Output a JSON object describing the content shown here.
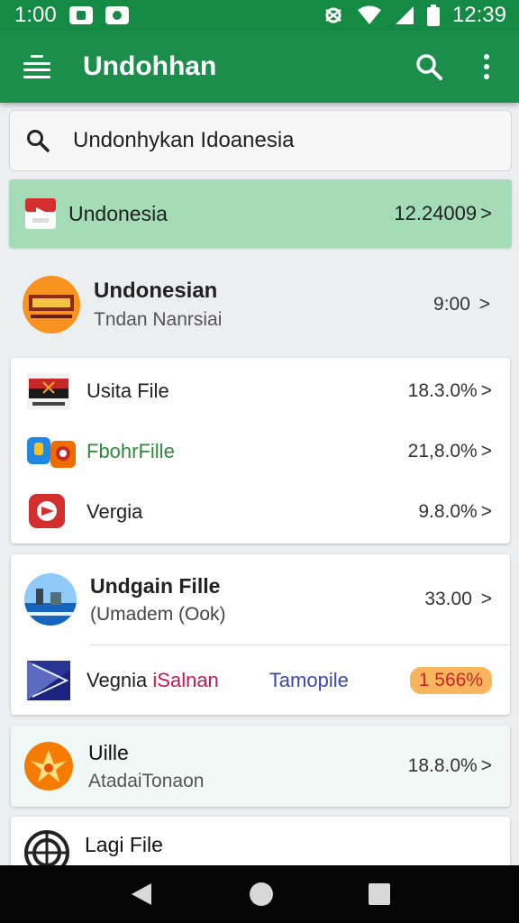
{
  "status_bar": {
    "time_left": "1:00",
    "time_right": "12:39"
  },
  "app_bar": {
    "title": "Undohhan"
  },
  "search": {
    "text": "Undonhykan Idoanesia"
  },
  "highlight_row": {
    "label": "Undonesia",
    "value": "12.24009",
    "chevron": ">"
  },
  "header_row": {
    "title": "Undonesian",
    "subtitle": "Tndan Nanrsiai",
    "value": "9:00",
    "chevron": ">"
  },
  "card1": {
    "items": [
      {
        "label": "Usita File",
        "value": "18.3.0%",
        "chevron": ">"
      },
      {
        "label": "FbohrFille",
        "value": "21,8.0%",
        "chevron": ">"
      },
      {
        "label": "Vergia",
        "value": "9.8.0%",
        "chevron": ">"
      }
    ]
  },
  "card2": {
    "title": "Undgain Fille",
    "subtitle": "(Umadem (Ook)",
    "value": "33.00",
    "chevron": ">",
    "row2": {
      "label_a": "Vegnia ",
      "label_b": "iSalnan",
      "middle": "Tamopile",
      "badge": "1  566%"
    }
  },
  "card3": {
    "title": "Uille",
    "subtitle": "AtadaiTonaon",
    "value": "18.8.0%",
    "chevron": ">"
  },
  "card4": {
    "title": "Lagi File"
  },
  "colors": {
    "primary": "#1b8e4b",
    "status_bar": "#148a45",
    "highlight": "#a3dcb6",
    "accent_green": "#2e8b3d",
    "accent_pink": "#c2185b",
    "accent_blue": "#3949ab",
    "badge": "#f9b45e"
  }
}
